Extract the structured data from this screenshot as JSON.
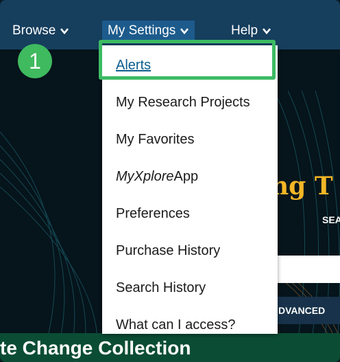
{
  "nav": {
    "browse": "Browse",
    "my_settings": "My Settings",
    "help": "Help"
  },
  "dropdown_items": [
    {
      "label": "Alerts"
    },
    {
      "label": "My Research Projects"
    },
    {
      "label": "My Favorites"
    },
    {
      "label_italic": "MyXplore",
      "label_rest": "App"
    },
    {
      "label": "Preferences"
    },
    {
      "label": "Purchase History"
    },
    {
      "label": "Search History"
    },
    {
      "label": "What can I access?"
    }
  ],
  "step_badge": "1",
  "hero": {
    "title_fragment": "ng T",
    "search_fragment": "SEA",
    "advanced_fragment": "DVANCED"
  },
  "footer": {
    "text_fragment": "te Change Collection"
  },
  "colors": {
    "nav_bg": "#163e5d",
    "active_nav_bg": "#1d5b8c",
    "highlight": "#3dbb63",
    "hero_title": "#f4b626",
    "footer_band": "#0b4d34"
  }
}
